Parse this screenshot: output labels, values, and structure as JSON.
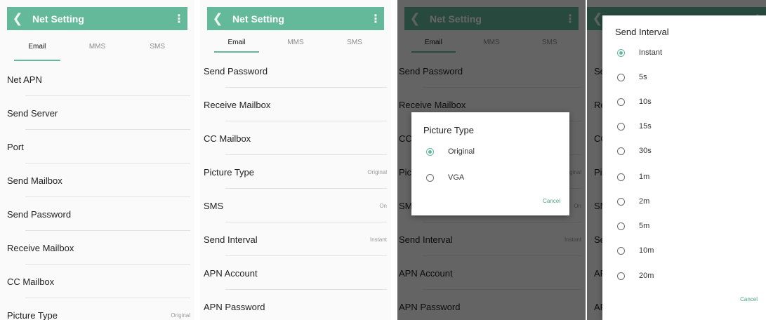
{
  "appbar": {
    "title": "Net Setting",
    "back_glyph": "❮",
    "more_glyph": "⋮",
    "color": "#64b99b"
  },
  "tabs": [
    "Email",
    "MMS",
    "SMS"
  ],
  "panel1": {
    "rows": [
      {
        "label": "Net APN",
        "value": ""
      },
      {
        "label": "Send Server",
        "value": ""
      },
      {
        "label": "Port",
        "value": ""
      },
      {
        "label": "Send Mailbox",
        "value": ""
      },
      {
        "label": "Send Password",
        "value": ""
      },
      {
        "label": "Receive Mailbox",
        "value": ""
      },
      {
        "label": "CC Mailbox",
        "value": ""
      },
      {
        "label": "Picture Type",
        "value": "Original"
      }
    ]
  },
  "panel2": {
    "rows": [
      {
        "label": "Send Password",
        "value": ""
      },
      {
        "label": "Receive Mailbox",
        "value": ""
      },
      {
        "label": "CC Mailbox",
        "value": ""
      },
      {
        "label": "Picture Type",
        "value": "Original"
      },
      {
        "label": "SMS",
        "value": "On"
      },
      {
        "label": "Send Interval",
        "value": "Instant"
      },
      {
        "label": "APN Account",
        "value": ""
      },
      {
        "label": "APN Password",
        "value": ""
      }
    ]
  },
  "picture_type_dialog": {
    "title": "Picture Type",
    "options": [
      {
        "label": "Original",
        "selected": true
      },
      {
        "label": "VGA",
        "selected": false
      }
    ],
    "cancel": "Cancel"
  },
  "send_interval_dialog": {
    "title": "Send Interval",
    "options": [
      {
        "label": "Instant",
        "selected": true
      },
      {
        "label": "5s",
        "selected": false
      },
      {
        "label": "10s",
        "selected": false
      },
      {
        "label": "15s",
        "selected": false
      },
      {
        "label": "30s",
        "selected": false
      },
      {
        "label": "1m",
        "selected": false
      },
      {
        "label": "2m",
        "selected": false
      },
      {
        "label": "5m",
        "selected": false
      },
      {
        "label": "10m",
        "selected": false
      },
      {
        "label": "20m",
        "selected": false
      }
    ],
    "cancel": "Cancel"
  }
}
